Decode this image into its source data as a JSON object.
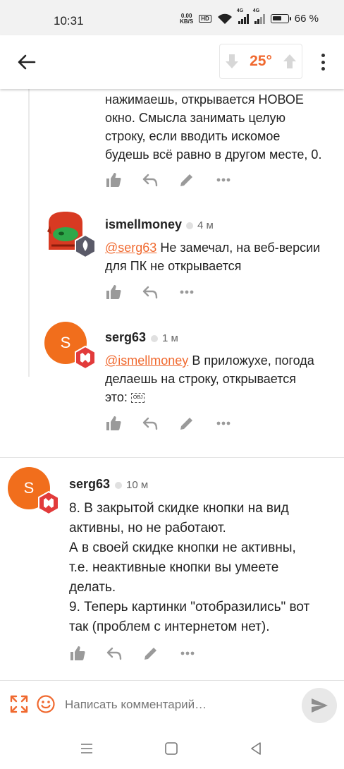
{
  "status_bar": {
    "time": "10:31",
    "net_speed_value": "0.00",
    "net_speed_unit": "KB/S",
    "hd_label": "HD",
    "signal_labels": [
      "4G",
      "4G"
    ],
    "battery_percent": "66 %",
    "battery_level": 0.66
  },
  "header": {
    "rating": "25°",
    "accent_color": "#f0692f"
  },
  "comments": [
    {
      "lines": [
        "нажимаешь, открывается НОВОЕ",
        "окно. Смысла занимать целую",
        "строку, если вводить искомое",
        "будешь всё равно в другом месте, 0."
      ],
      "actions": [
        "like-icon",
        "reply-icon",
        "edit-icon",
        "more-icon"
      ]
    },
    {
      "author": "ismellmoney",
      "time": "4 м",
      "mention": "@serg63",
      "text_first": " Не замечал, на веб-версии",
      "text_second": "для ПК не открывается",
      "actions": [
        "like-icon",
        "reply-icon",
        "more-icon"
      ]
    },
    {
      "author": "serg63",
      "avatar_letter": "S",
      "time": "1 м",
      "mention": "@ismellmoney",
      "text_first": " В приложухе, погода",
      "text_second": "делаешь на строку, открывается",
      "text_third": "это: ",
      "obj_label": "OBJ",
      "actions": [
        "like-icon",
        "reply-icon",
        "edit-icon",
        "more-icon"
      ]
    },
    {
      "author": "serg63",
      "avatar_letter": "S",
      "time": "10 м",
      "lines": [
        "8. В закрытой скидке кнопки на вид",
        "активны, но не работают.",
        "А в своей скидке кнопки не активны,",
        "т.е. неактивные кнопки вы умеете",
        "делать.",
        "9. Теперь картинки \"отобразились\" вот",
        "так (проблем с интернетом нет)."
      ],
      "actions": [
        "like-icon",
        "reply-icon",
        "edit-icon",
        "more-icon"
      ]
    }
  ],
  "composer": {
    "placeholder": "Написать комментарий…"
  }
}
